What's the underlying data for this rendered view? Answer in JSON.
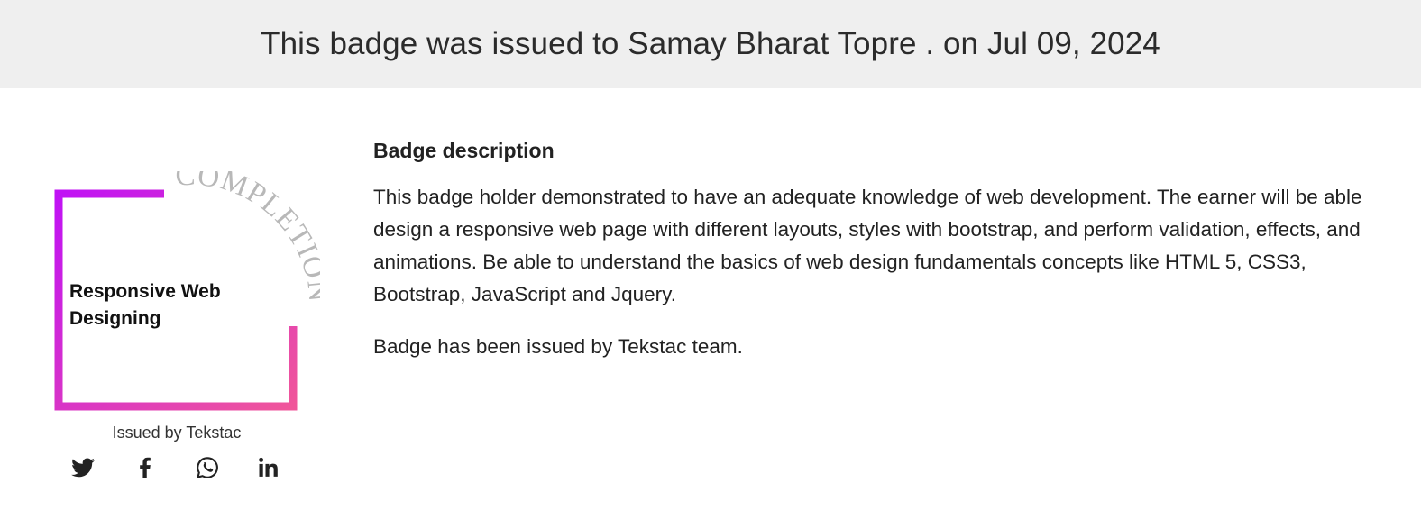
{
  "header": {
    "title": "This badge was issued to Samay Bharat Topre . on Jul 09, 2024"
  },
  "badge": {
    "arc_text": "COMPLETION",
    "name_line1": "Responsive Web",
    "name_line2": "Designing",
    "frame_gradient_start": "#c012f5",
    "frame_gradient_end": "#f0569a",
    "arc_text_color": "#b8b8b8",
    "issued_by": "Issued by Tekstac"
  },
  "social": [
    {
      "name": "twitter",
      "icon": "twitter-icon"
    },
    {
      "name": "facebook",
      "icon": "facebook-icon"
    },
    {
      "name": "whatsapp",
      "icon": "whatsapp-icon"
    },
    {
      "name": "linkedin",
      "icon": "linkedin-icon"
    }
  ],
  "description": {
    "heading": "Badge description",
    "text": "This badge holder demonstrated to have an adequate knowledge of web development. The earner will be able design a responsive web page with different layouts, styles with bootstrap, and perform validation, effects, and animations. Be able to understand the basics of web design fundamentals concepts like HTML 5, CSS3, Bootstrap, JavaScript and Jquery.",
    "issuer_note": "Badge has been issued by Tekstac team."
  }
}
